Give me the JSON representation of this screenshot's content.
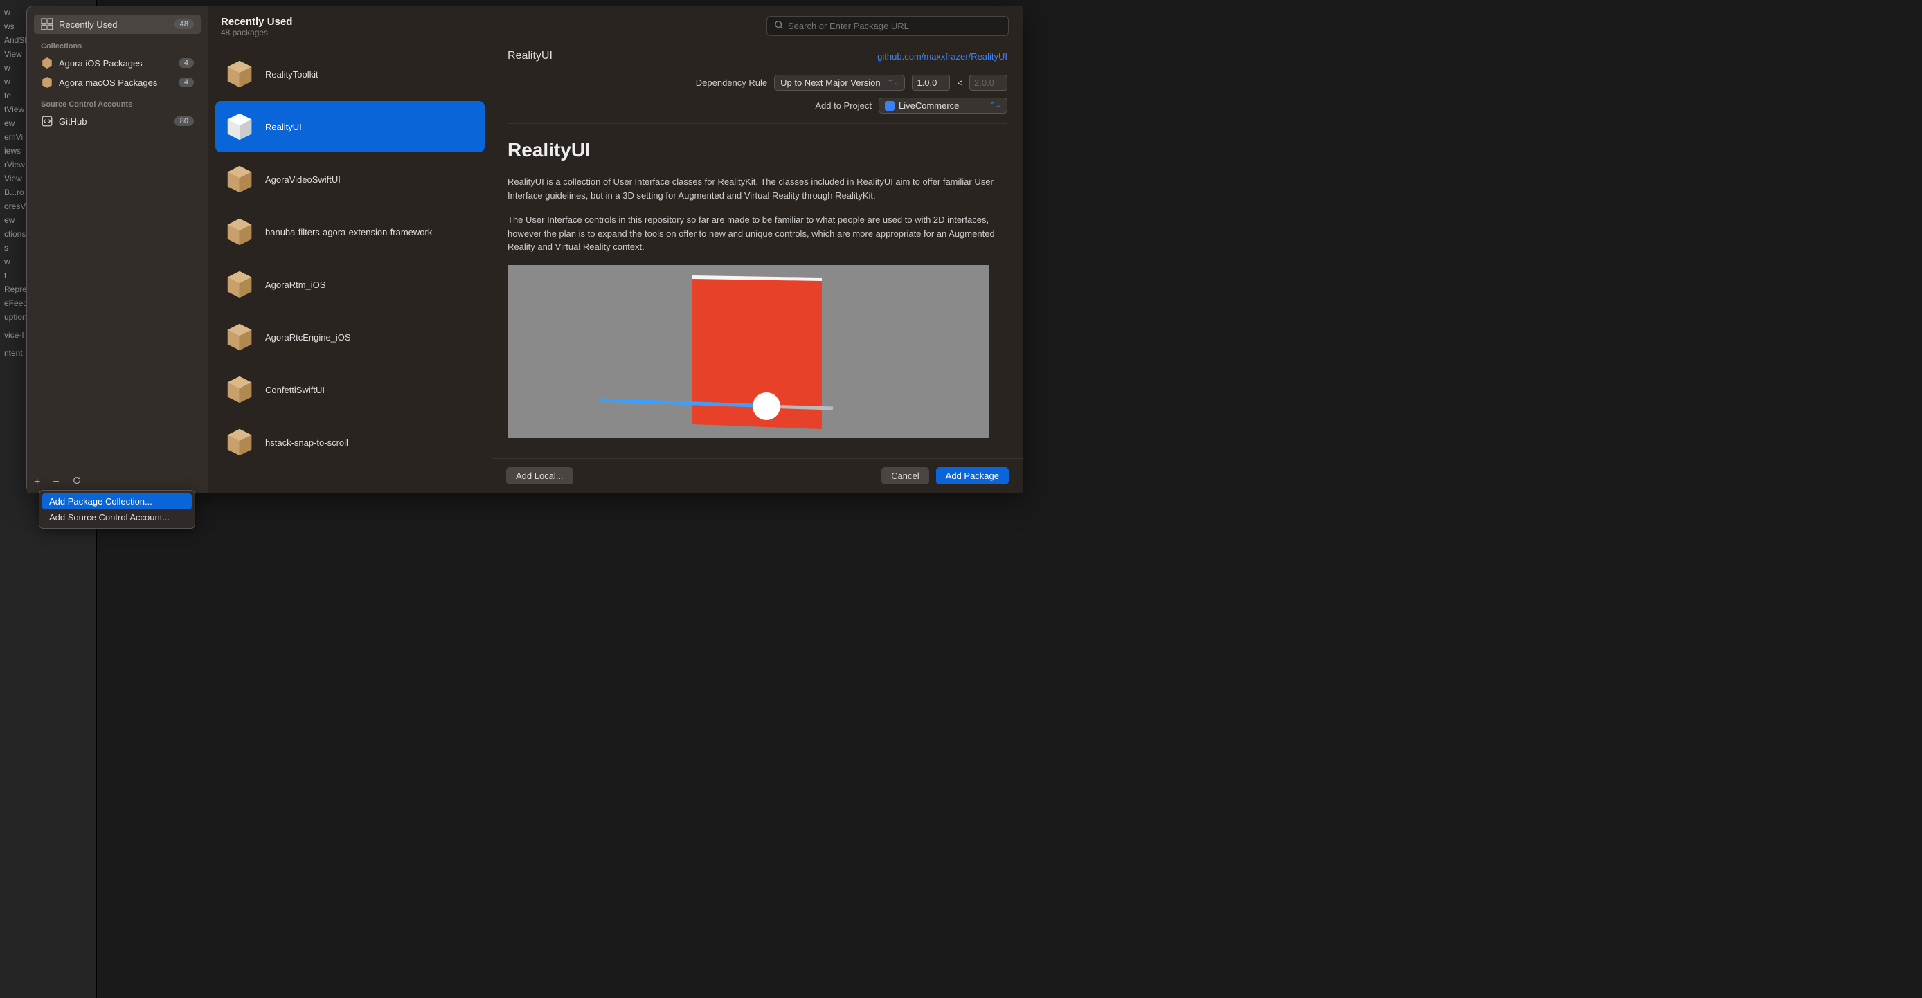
{
  "background_items": [
    "w",
    "ws",
    "AndSh",
    "View",
    "w",
    "w",
    "te",
    "tView",
    "ew",
    "emVi",
    "iews",
    "rView",
    "View",
    "B...ro",
    "oresV",
    "ew",
    "ctions",
    "s",
    "w",
    "t",
    "Repre",
    "eFeed",
    "uption",
    "",
    "vice-I",
    "",
    "ntent"
  ],
  "sidebar": {
    "recently_used": {
      "label": "Recently Used",
      "badge": "48"
    },
    "collections_header": "Collections",
    "collections": [
      {
        "label": "Agora iOS Packages",
        "badge": "4"
      },
      {
        "label": "Agora macOS Packages",
        "badge": "4"
      }
    ],
    "source_control_header": "Source Control Accounts",
    "accounts": [
      {
        "label": "GitHub",
        "badge": "80"
      }
    ]
  },
  "middle": {
    "title": "Recently Used",
    "subtitle": "48 packages",
    "packages": [
      "RealityToolkit",
      "RealityUI",
      "AgoraVideoSwiftUI",
      "banuba-filters-agora-extension-framework",
      "AgoraRtm_iOS",
      "AgoraRtcEngine_iOS",
      "ConfettiSwiftUI",
      "hstack-snap-to-scroll"
    ],
    "selected_index": 1
  },
  "search": {
    "placeholder": "Search or Enter Package URL"
  },
  "detail": {
    "name": "RealityUI",
    "link": "github.com/maxxfrazer/RealityUI",
    "dependency_rule_label": "Dependency Rule",
    "dependency_rule_value": "Up to Next Major Version",
    "version_from": "1.0.0",
    "version_separator": "<",
    "version_to": "2.0.0",
    "add_to_project_label": "Add to Project",
    "add_to_project_value": "LiveCommerce",
    "readme_title": "RealityUI",
    "readme_p1": "RealityUI is a collection of User Interface classes for RealityKit. The classes included in RealityUI aim to offer familiar User Interface guidelines, but in a 3D setting for Augmented and Virtual Reality through RealityKit.",
    "readme_p2": "The User Interface controls in this repository so far are made to be familiar to what people are used to with 2D interfaces, however the plan is to expand the tools on offer to new and unique controls, which are more appropriate for an Augmented Reality and Virtual Reality context."
  },
  "footer": {
    "add_local": "Add Local...",
    "cancel": "Cancel",
    "add_package": "Add Package"
  },
  "context_menu": {
    "item1": "Add Package Collection...",
    "item2": "Add Source Control Account..."
  }
}
